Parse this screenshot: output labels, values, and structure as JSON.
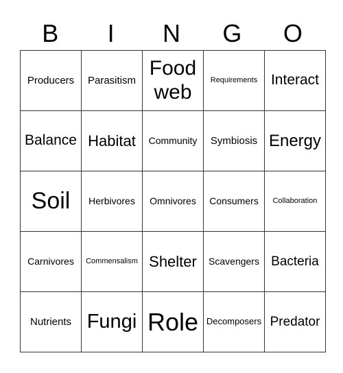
{
  "header": [
    "B",
    "I",
    "N",
    "G",
    "O"
  ],
  "rows": [
    [
      "Producers",
      "Parasitism",
      "Food web",
      "Requirements",
      "Interact"
    ],
    [
      "Balance",
      "Habitat",
      "Community",
      "Symbiosis",
      "Energy"
    ],
    [
      "Soil",
      "Herbivores",
      "Omnivores",
      "Consumers",
      "Collaboration"
    ],
    [
      "Carnivores",
      "Commensalism",
      "Shelter",
      "Scavengers",
      "Bacteria"
    ],
    [
      "Nutrients",
      "Fungi",
      "Role",
      "Decomposers",
      "Predator"
    ]
  ]
}
